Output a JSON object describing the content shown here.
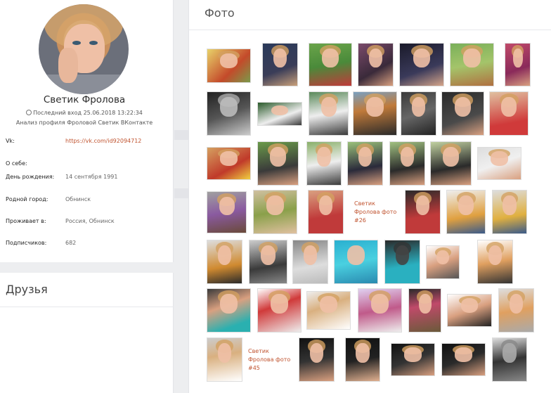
{
  "profile": {
    "name": "Светик Фролова",
    "last_visit": "Последний вход 25.06.2018 13:22:34",
    "analysis": "Анализ профиля Фроловой Светик ВКонтакте"
  },
  "info": {
    "vk_label": "Vk:",
    "vk_link": "https://vk.com/id92094712",
    "about_label": "О себе:",
    "birthday_label": "День рождения:",
    "birthday_value": "14 сентября 1991",
    "hometown_label": "Родной город:",
    "hometown_value": "Обнинск",
    "lives_label": "Проживает в:",
    "lives_value": "Россия, Обнинск",
    "followers_label": "Подписчиков:",
    "followers_value": "682"
  },
  "friends": {
    "title": "Друзья"
  },
  "photos": {
    "title": "Фото",
    "caption_26": "Светик Фролова фото #26",
    "caption_45": "Светик Фролова фото #45"
  },
  "colors": {
    "link": "#c0532f",
    "background": "#edeef0",
    "card": "#ffffff"
  }
}
